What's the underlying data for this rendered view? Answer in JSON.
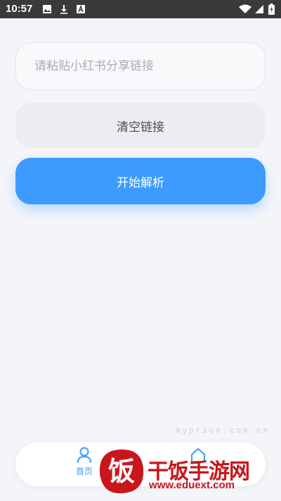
{
  "status_bar": {
    "time": "10:57",
    "icons": [
      "image-icon",
      "download-icon",
      "font-icon",
      "wifi-icon",
      "signal-icon",
      "battery-icon"
    ]
  },
  "main": {
    "paste_placeholder": "请粘贴小红书分享链接",
    "paste_value": "",
    "clear_button": "清空链接",
    "parse_button": "开始解析"
  },
  "tab_bar": {
    "items": [
      {
        "label": "首页",
        "icon": "user-icon",
        "active": true
      },
      {
        "label": "",
        "icon": "home-icon",
        "active": false
      }
    ]
  },
  "watermark": {
    "logo_char": "饭",
    "title": "干饭手游网",
    "url": "www.eduext.com",
    "sub": "myprice.com.cn"
  },
  "colors": {
    "accent": "#3d9bff",
    "background": "#f3f5f9",
    "watermark": "#c8161d"
  }
}
